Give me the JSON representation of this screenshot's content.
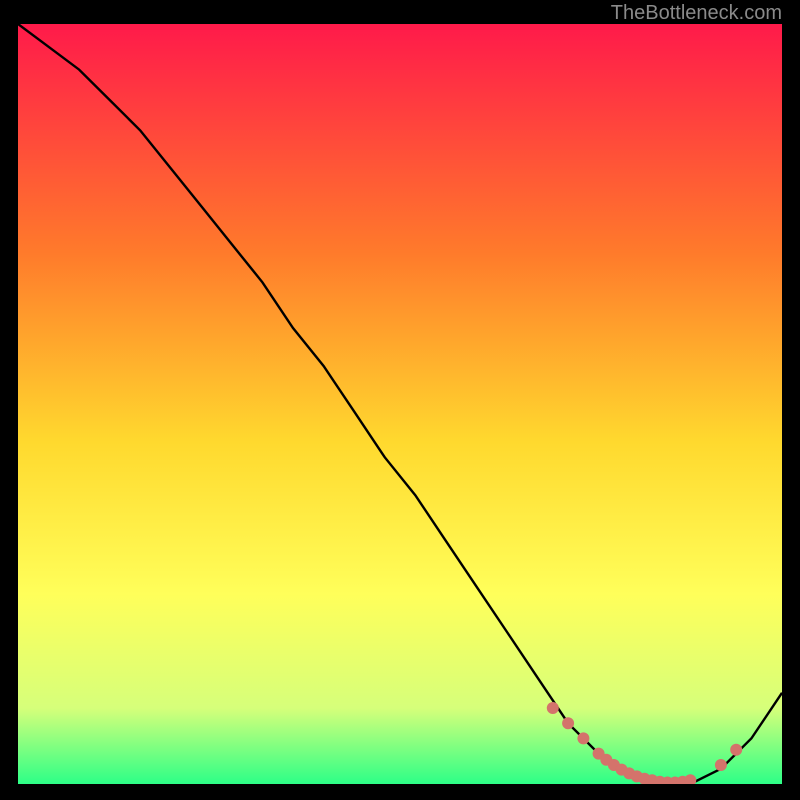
{
  "attribution": "TheBottleneck.com",
  "colors": {
    "gradient_top": "#ff1a4a",
    "gradient_mid1": "#ff7a2b",
    "gradient_mid2": "#ffd92e",
    "gradient_mid3": "#ffff5a",
    "gradient_mid4": "#d6ff7a",
    "gradient_bottom": "#2dff87",
    "curve": "#000000",
    "marker": "#d4736b",
    "frame_bg": "#000000"
  },
  "chart_data": {
    "type": "line",
    "title": "",
    "xlabel": "",
    "ylabel": "",
    "xlim": [
      0,
      100
    ],
    "ylim": [
      0,
      100
    ],
    "series": [
      {
        "name": "bottleneck-curve",
        "x": [
          0,
          4,
          8,
          12,
          16,
          20,
          24,
          28,
          32,
          36,
          40,
          44,
          48,
          52,
          56,
          60,
          64,
          68,
          72,
          76,
          80,
          84,
          88,
          92,
          96,
          100
        ],
        "y": [
          100,
          97,
          94,
          90,
          86,
          81,
          76,
          71,
          66,
          60,
          55,
          49,
          43,
          38,
          32,
          26,
          20,
          14,
          8,
          4,
          1,
          0,
          0,
          2,
          6,
          12
        ]
      }
    ],
    "markers": {
      "name": "highlight-range",
      "x": [
        70,
        72,
        74,
        76,
        77,
        78,
        79,
        80,
        81,
        82,
        83,
        84,
        85,
        86,
        87,
        88,
        92,
        94
      ],
      "y": [
        10,
        8,
        6,
        4,
        3.2,
        2.5,
        1.9,
        1.4,
        1.0,
        0.7,
        0.5,
        0.3,
        0.2,
        0.2,
        0.3,
        0.5,
        2.5,
        4.5
      ]
    }
  }
}
